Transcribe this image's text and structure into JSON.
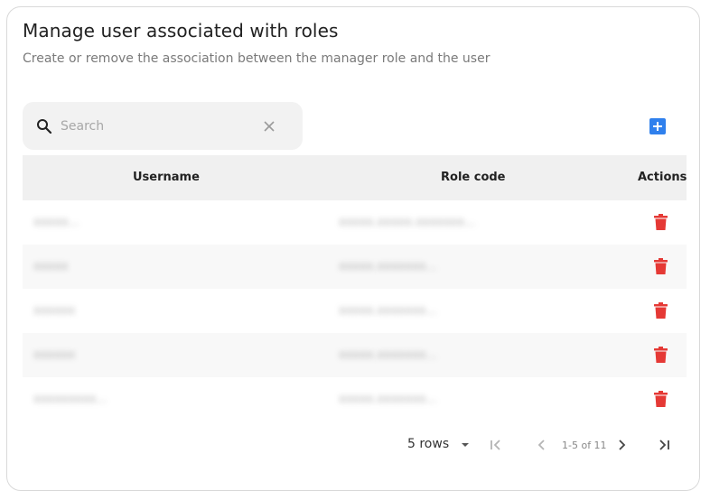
{
  "header": {
    "title": "Manage user associated with roles",
    "subtitle": "Create or remove the association between the manager role and the user"
  },
  "search": {
    "placeholder": "Search",
    "value": ""
  },
  "table": {
    "columns": [
      "Username",
      "Role code",
      "Actions"
    ],
    "rows": [
      {
        "username": "xxxxx...",
        "role": "xxxxx.xxxxx.xxxxxxx..."
      },
      {
        "username": "xxxxx",
        "role": "xxxxx.xxxxxxx..."
      },
      {
        "username": "xxxxxx",
        "role": "xxxxx.xxxxxxx..."
      },
      {
        "username": "xxxxxx",
        "role": "xxxxx.xxxxxxx..."
      },
      {
        "username": "xxxxxxxxx...",
        "role": "xxxxx.xxxxxxx..."
      }
    ]
  },
  "pagination": {
    "rows_per_page": "5 rows",
    "range": "1-5 of 11"
  },
  "colors": {
    "accent": "#2f80ed",
    "delete": "#e53935",
    "header_bg": "#f0f0f0",
    "search_bg": "#f2f2f2"
  },
  "icons": [
    "search-icon",
    "close-icon",
    "add-icon",
    "trash-icon",
    "chevron-down-icon",
    "first-page-icon",
    "prev-page-icon",
    "next-page-icon",
    "last-page-icon"
  ]
}
